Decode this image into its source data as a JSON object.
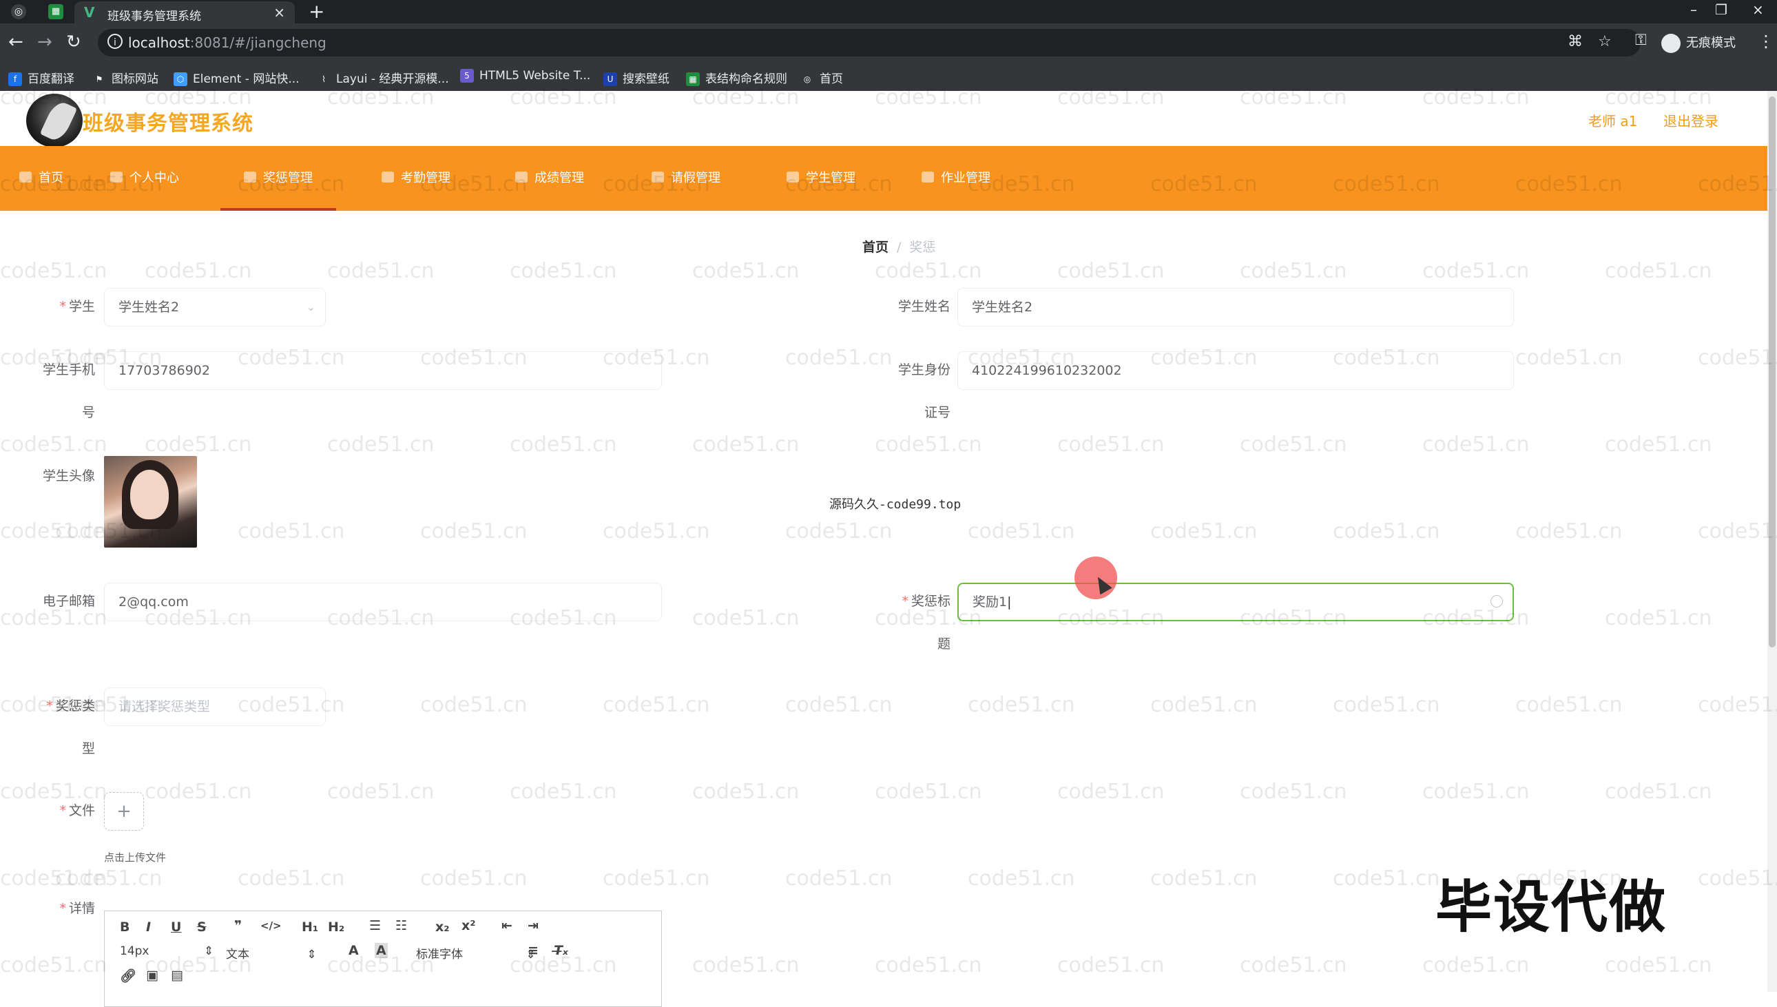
{
  "browser": {
    "tab_title": "班级事务管理系统",
    "url_host": "localhost",
    "url_rest": ":8081/#/jiangcheng",
    "incognito_label": "无痕模式",
    "bookmarks": [
      {
        "label": "百度翻译",
        "color": "#1a73e8"
      },
      {
        "label": "图标网站",
        "color": "#333333"
      },
      {
        "label": "Element - 网站快...",
        "color": "#409eff"
      },
      {
        "label": "Layui - 经典开源模...",
        "color": "#555555"
      },
      {
        "label": "HTML5 Website T...",
        "color": "#6a5acd"
      },
      {
        "label": "搜索壁纸",
        "color": "#1e40af"
      },
      {
        "label": "表结构命名规则",
        "color": "#1e8e3e"
      },
      {
        "label": "首页",
        "color": "#5f6368"
      }
    ]
  },
  "app": {
    "title": "班级事务管理系统",
    "user_label": "老师 a1",
    "logout_label": "退出登录",
    "accent_color": "#f7931e"
  },
  "nav": {
    "items": [
      {
        "label": "首页"
      },
      {
        "label": "个人中心"
      },
      {
        "label": "奖惩管理"
      },
      {
        "label": "考勤管理"
      },
      {
        "label": "成绩管理"
      },
      {
        "label": "请假管理"
      },
      {
        "label": "学生管理"
      },
      {
        "label": "作业管理"
      }
    ],
    "active_index": 2
  },
  "breadcrumb": {
    "home": "首页",
    "separator": "/",
    "current": "奖惩"
  },
  "form": {
    "student_label": "学生",
    "student_value": "学生姓名2",
    "student_name_label": "学生姓名",
    "student_name_value": "学生姓名2",
    "phone_label_1": "学生手机",
    "phone_label_2": "号",
    "phone_value": "17703786902",
    "id_label_1": "学生身份",
    "id_label_2": "证号",
    "id_value": "410224199610232002",
    "avatar_label": "学生头像",
    "email_label": "电子邮箱",
    "email_value": "2@qq.com",
    "reward_title_label_1": "奖惩标",
    "reward_title_label_2": "题",
    "reward_title_value": "奖励1",
    "reward_type_label_1": "奖惩类",
    "reward_type_label_2": "型",
    "reward_type_placeholder": "请选择奖惩类型",
    "file_label": "文件",
    "upload_tip": "点击上传文件",
    "detail_label": "详情",
    "required_mark": "*"
  },
  "editor": {
    "font_size": "14px",
    "paragraph": "文本",
    "font_family": "标准字体"
  },
  "overlay": {
    "center_note": "源码久久-code99.top",
    "stamp": "毕设代做",
    "watermark": "code51.cn"
  }
}
